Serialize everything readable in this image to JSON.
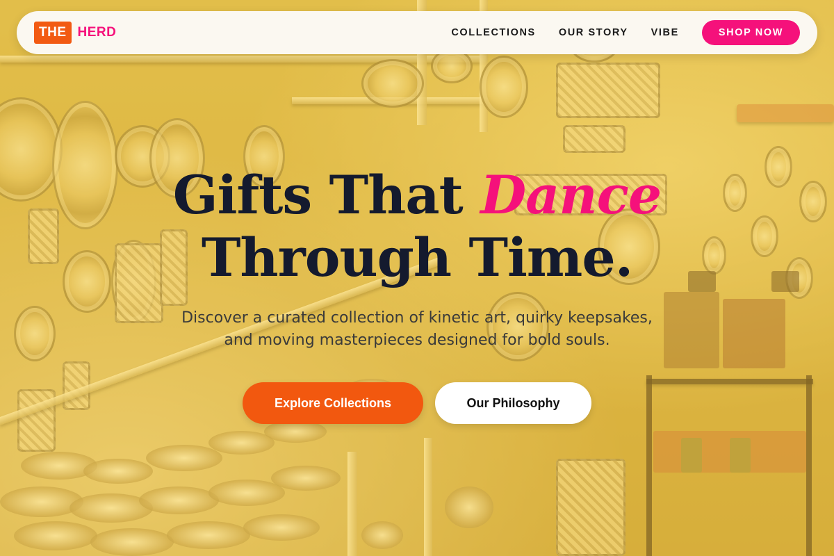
{
  "nav": {
    "logo_box": "THE",
    "logo_text": "HERD",
    "links": [
      {
        "label": "COLLECTIONS"
      },
      {
        "label": "OUR STORY"
      },
      {
        "label": "VIBE"
      }
    ],
    "cta_label": "SHOP NOW"
  },
  "hero": {
    "headline_part1": "Gifts That ",
    "headline_accent": "Dance",
    "headline_part2": "Through Time.",
    "subtitle": "Discover a curated collection of kinetic art, quirky keepsakes, and moving masterpieces designed for bold souls.",
    "primary_button": "Explore Collections",
    "secondary_button": "Our Philosophy"
  },
  "colors": {
    "brand_orange": "#f25a12",
    "brand_pink": "#f5117b",
    "headline_navy": "#141a2e",
    "overlay_yellow": "#f6cd46"
  }
}
